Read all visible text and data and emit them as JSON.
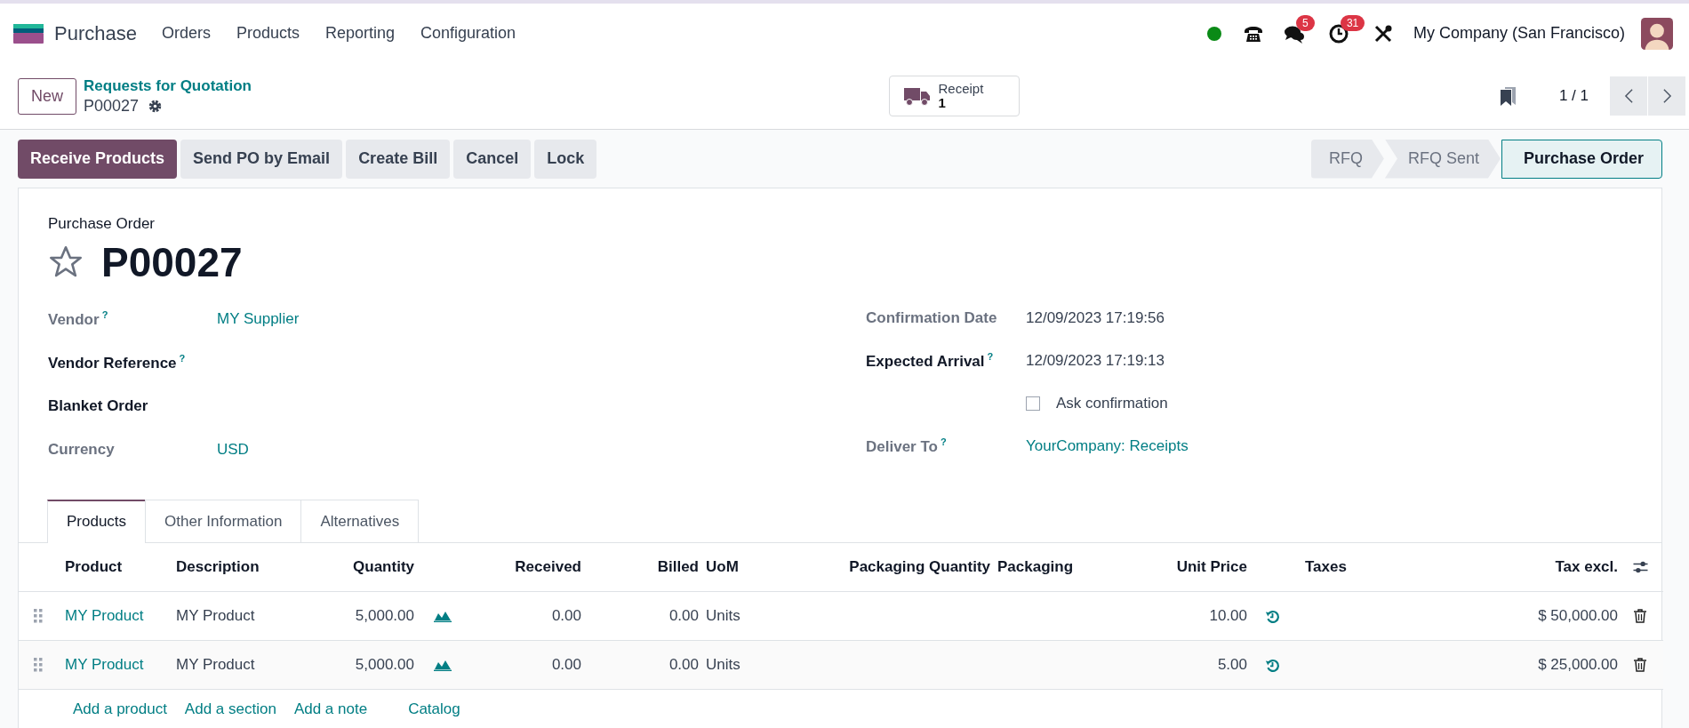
{
  "navbar": {
    "app_name": "Purchase",
    "menu": [
      "Orders",
      "Products",
      "Reporting",
      "Configuration"
    ],
    "messages_count": "5",
    "activities_count": "31",
    "company": "My Company (San Francisco)"
  },
  "control_panel": {
    "new_button": "New",
    "breadcrumb": "Requests for Quotation",
    "record": "P00027",
    "smart_button": {
      "label": "Receipt",
      "value": "1"
    },
    "pager": "1 / 1"
  },
  "actions": [
    {
      "label": "Receive Products",
      "kind": "primary"
    },
    {
      "label": "Send PO by Email",
      "kind": "secondary"
    },
    {
      "label": "Create Bill",
      "kind": "secondary"
    },
    {
      "label": "Cancel",
      "kind": "secondary"
    },
    {
      "label": "Lock",
      "kind": "secondary"
    }
  ],
  "stages": [
    {
      "label": "RFQ",
      "selected": false
    },
    {
      "label": "RFQ Sent",
      "selected": false
    },
    {
      "label": "Purchase Order",
      "selected": true
    }
  ],
  "form": {
    "subtitle": "Purchase Order",
    "name": "P00027",
    "starred": false,
    "left_fields": [
      {
        "label": "Vendor",
        "help": "?",
        "required": false,
        "value": "MY Supplier",
        "link": true
      },
      {
        "label": "Vendor Reference",
        "help": "?",
        "required": true
      },
      {
        "label": "Blanket Order",
        "required": true
      },
      {
        "label": "Currency",
        "required": false,
        "value": "USD",
        "link": true
      }
    ],
    "right_fields": [
      {
        "label": "Confirmation Date",
        "required": false,
        "value": "12/09/2023 17:19:56",
        "link": false,
        "kind": "text"
      },
      {
        "label": "Expected Arrival",
        "help": "?",
        "required": true,
        "value": "12/09/2023 17:19:13",
        "link": false,
        "kind": "text"
      },
      {
        "kind": "checkbox",
        "value": "Ask confirmation",
        "checked": false
      },
      {
        "label": "Deliver To",
        "help": "?",
        "required": false,
        "value": "YourCompany: Receipts",
        "link": true,
        "kind": "text"
      }
    ]
  },
  "tabs": [
    {
      "label": "Products",
      "selected": true
    },
    {
      "label": "Other Information",
      "selected": false
    },
    {
      "label": "Alternatives",
      "selected": false
    }
  ],
  "table": {
    "columns": [
      "Product",
      "Description",
      "Quantity",
      "Received",
      "Billed",
      "UoM",
      "Packaging Quantity",
      "Packaging",
      "Unit Price",
      "Taxes",
      "Tax excl."
    ],
    "rows": [
      {
        "product": "MY Product",
        "description": "MY Product",
        "quantity": "5,000.00",
        "received": "0.00",
        "billed": "0.00",
        "uom": "Units",
        "unit_price": "10.00",
        "subtotal": "$ 50,000.00"
      },
      {
        "product": "MY Product",
        "description": "MY Product",
        "quantity": "5,000.00",
        "received": "0.00",
        "billed": "0.00",
        "uom": "Units",
        "unit_price": "5.00",
        "subtotal": "$ 25,000.00"
      }
    ],
    "add_links": [
      "Add a product",
      "Add a section",
      "Add a note"
    ],
    "catalog": "Catalog"
  }
}
